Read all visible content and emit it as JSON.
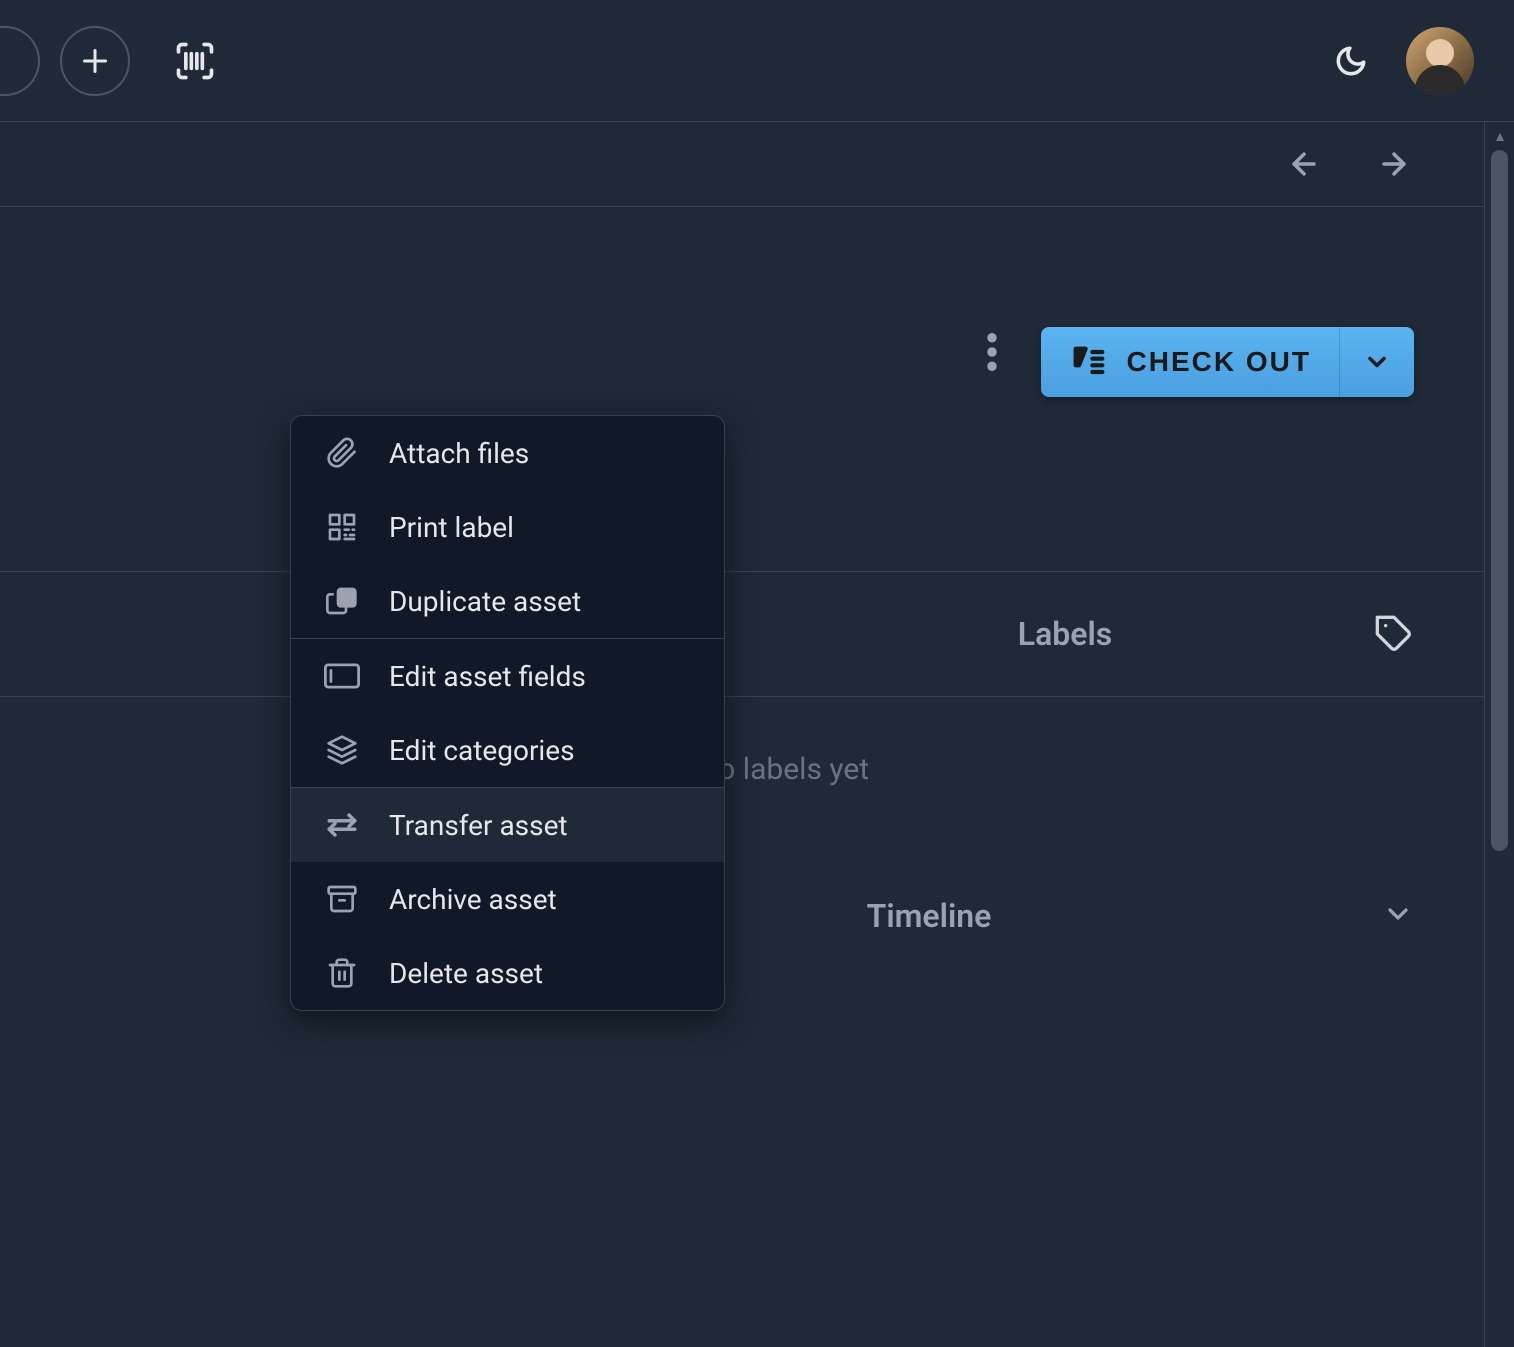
{
  "header": {
    "add_label": "Add",
    "scan_label": "Scan"
  },
  "actions": {
    "checkout_label": "CHECK OUT"
  },
  "menu": {
    "attach_files": "Attach files",
    "print_label": "Print label",
    "duplicate_asset": "Duplicate asset",
    "edit_asset_fields": "Edit asset fields",
    "edit_categories": "Edit categories",
    "transfer_asset": "Transfer asset",
    "archive_asset": "Archive asset",
    "delete_asset": "Delete asset"
  },
  "sections": {
    "labels_title": "Labels",
    "labels_empty": "No labels yet",
    "timeline_title": "Timeline"
  }
}
